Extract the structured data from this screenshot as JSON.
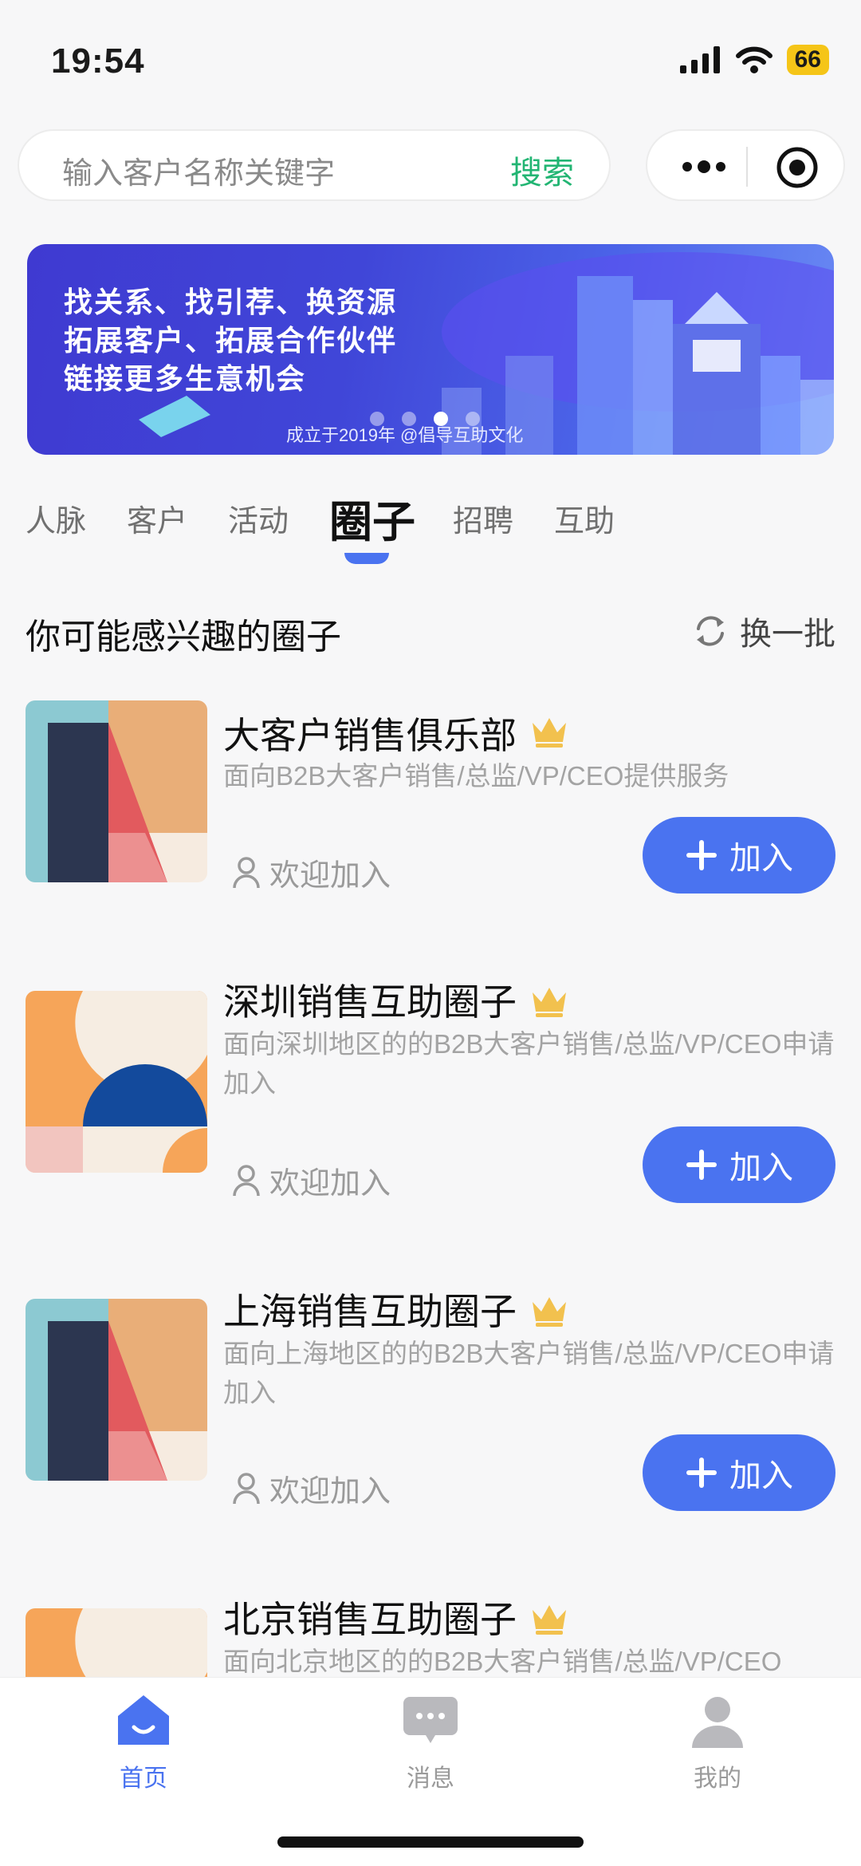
{
  "status_bar": {
    "time": "19:54",
    "battery": "66"
  },
  "search": {
    "placeholder": "输入客户名称关键字",
    "button_label": "搜索"
  },
  "banner": {
    "lines": [
      "找关系、找引荐、换资源",
      "拓展客户、拓展合作伙伴",
      "链接更多生意机会"
    ],
    "caption": "成立于2019年 @倡导互助文化"
  },
  "tabs": [
    {
      "label": "人脉",
      "active": false
    },
    {
      "label": "客户",
      "active": false
    },
    {
      "label": "活动",
      "active": false
    },
    {
      "label": "圈子",
      "active": true
    },
    {
      "label": "招聘",
      "active": false
    },
    {
      "label": "互助",
      "active": false
    }
  ],
  "section": {
    "title": "你可能感兴趣的圈子",
    "refresh_label": "换一批"
  },
  "circles": [
    {
      "title": "大客户销售俱乐部",
      "description": "面向B2B大客户销售/总监/VP/CEO提供服务",
      "welcome": "欢迎加入",
      "join_label": "加入",
      "thumb": "red-navy"
    },
    {
      "title": "深圳销售互助圈子",
      "description": "面向深圳地区的的B2B大客户销售/总监/VP/CEO申请加入",
      "welcome": "欢迎加入",
      "join_label": "加入",
      "thumb": "orange-blue"
    },
    {
      "title": "上海销售互助圈子",
      "description": "面向上海地区的的B2B大客户销售/总监/VP/CEO申请加入",
      "welcome": "欢迎加入",
      "join_label": "加入",
      "thumb": "red-navy"
    },
    {
      "title": "北京销售互助圈子",
      "description": "面向北京地区的的B2B大客户销售/总监/VP/CEO",
      "welcome": "",
      "join_label": "",
      "thumb": "orange-blue"
    }
  ],
  "bottom_nav": [
    {
      "label": "首页",
      "icon": "home-icon",
      "active": true
    },
    {
      "label": "消息",
      "icon": "chat-icon",
      "active": false
    },
    {
      "label": "我的",
      "icon": "user-icon",
      "active": false
    }
  ],
  "colors": {
    "accent": "#4a73f0",
    "search_green": "#22b573",
    "crown_gold": "#f2c14e"
  }
}
